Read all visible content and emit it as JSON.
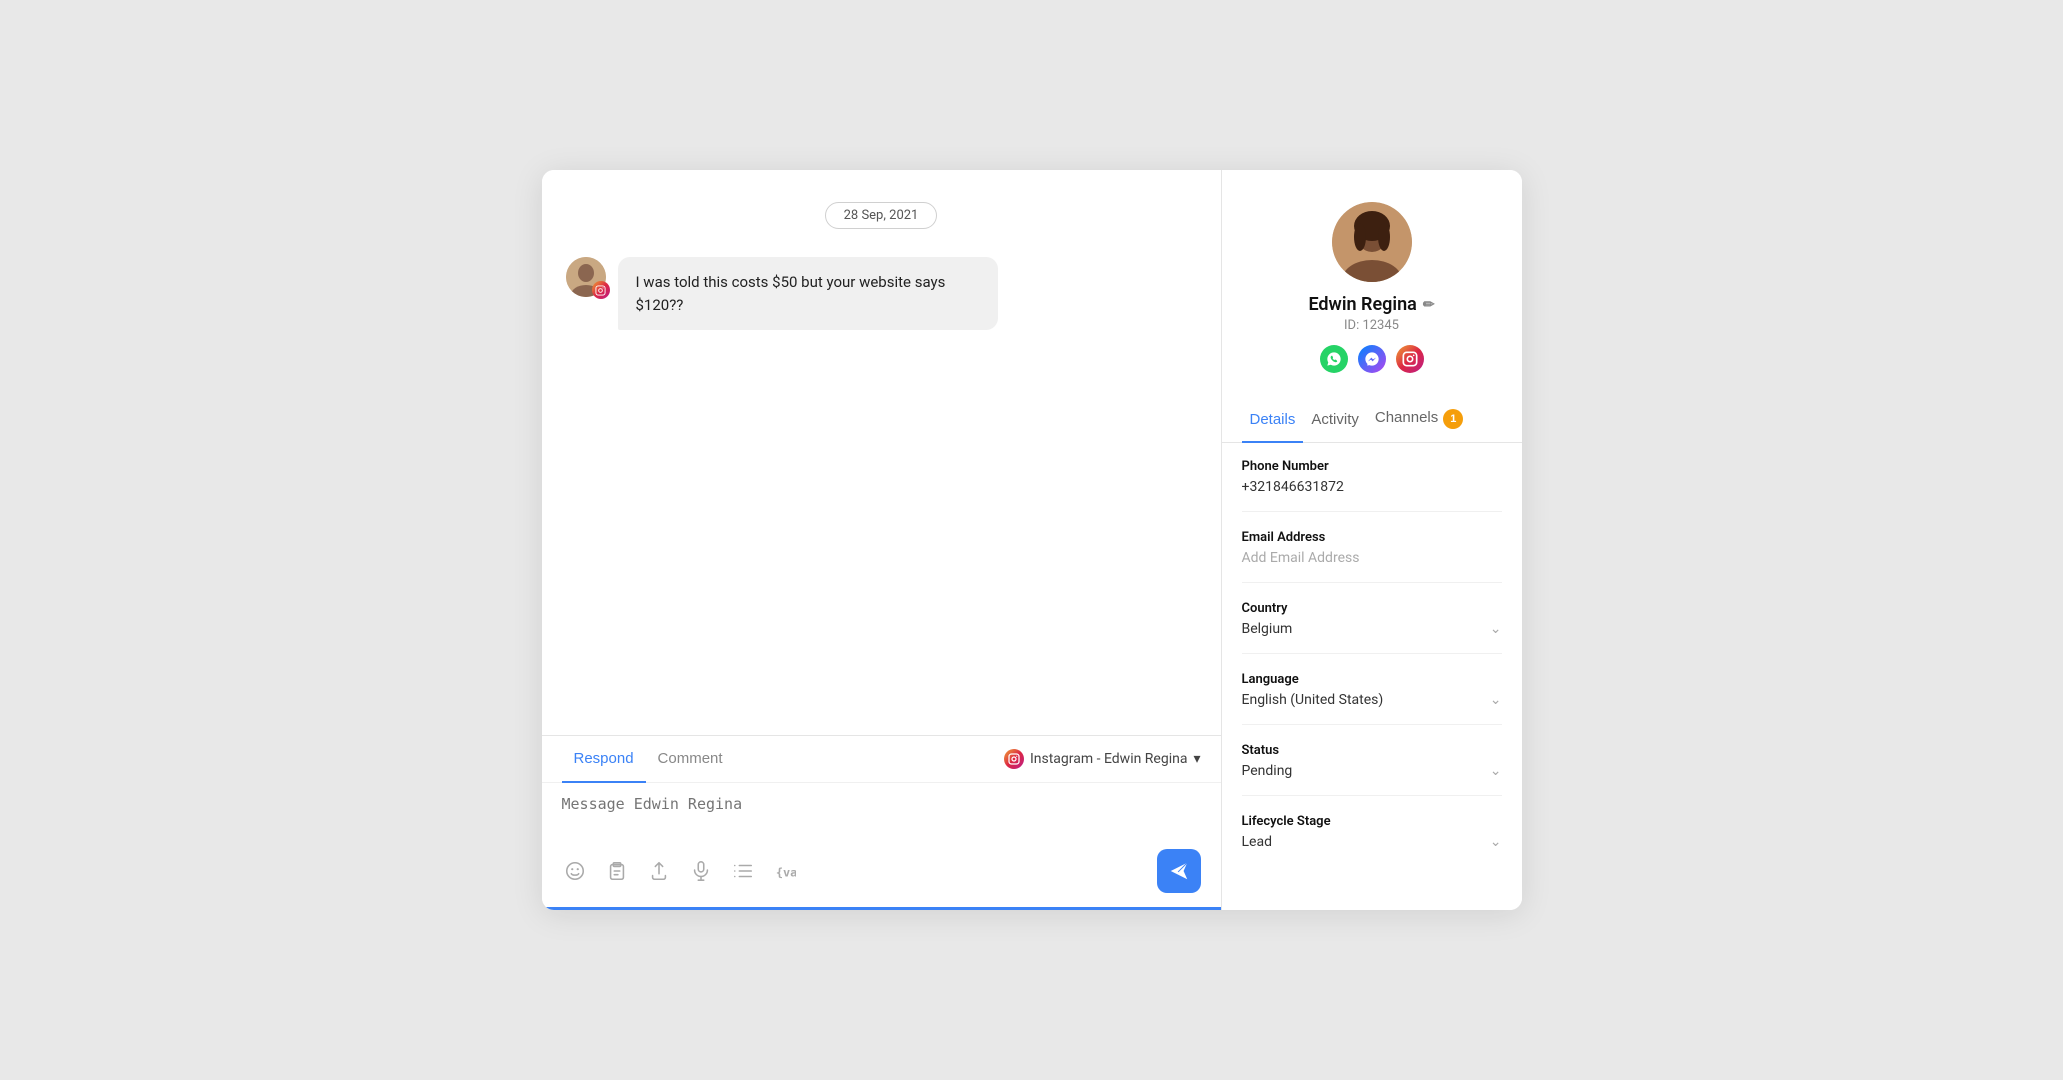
{
  "chat": {
    "date_badge": "28 Sep, 2021",
    "message": "I was told this costs $50 but your website says $120??",
    "input_placeholder": "Message Edwin Regina",
    "reply_tabs": [
      {
        "label": "Respond",
        "active": true
      },
      {
        "label": "Comment",
        "active": false
      }
    ],
    "channel_selector": "Instagram - Edwin Regina",
    "toolbar_icons": [
      "emoji",
      "clipboard",
      "upload",
      "microphone",
      "list",
      "variable"
    ]
  },
  "contact": {
    "name": "Edwin Regina",
    "id": "ID: 12345",
    "channels": [
      "whatsapp",
      "messenger",
      "instagram"
    ],
    "tabs": [
      {
        "label": "Details",
        "active": true
      },
      {
        "label": "Activity",
        "active": false
      },
      {
        "label": "Channels",
        "active": false,
        "badge": "1"
      }
    ],
    "fields": {
      "phone_label": "Phone Number",
      "phone_value": "+321846631872",
      "email_label": "Email Address",
      "email_placeholder": "Add Email Address",
      "country_label": "Country",
      "country_value": "Belgium",
      "language_label": "Language",
      "language_value": "English (United States)",
      "status_label": "Status",
      "status_value": "Pending",
      "lifecycle_label": "Lifecycle Stage",
      "lifecycle_value": "Lead"
    }
  },
  "icons": {
    "send": "▶",
    "edit": "✏",
    "chevron_down": "⌄"
  }
}
